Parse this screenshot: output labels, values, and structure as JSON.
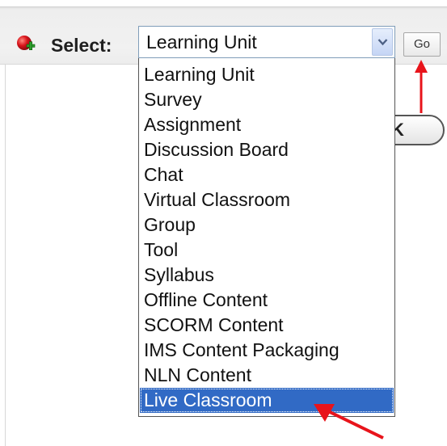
{
  "toolbar": {
    "add_icon": "add-circle-icon",
    "select_label": "Select:",
    "go_label": "Go"
  },
  "select": {
    "current_value": "Learning Unit",
    "arrow_icon": "chevron-down-icon",
    "options": [
      "Learning Unit",
      "Survey",
      "Assignment",
      "Discussion Board",
      "Chat",
      "Virtual Classroom",
      "Group",
      "Tool",
      "Syllabus",
      "Offline Content",
      "SCORM Content",
      "IMS Content Packaging",
      "NLN Content",
      "Live Classroom"
    ],
    "highlighted_option": "Live Classroom"
  },
  "background_button": {
    "label": "K"
  },
  "annotations": {
    "arrow_color": "#e8141b",
    "highlight_color": "#316ac5"
  }
}
